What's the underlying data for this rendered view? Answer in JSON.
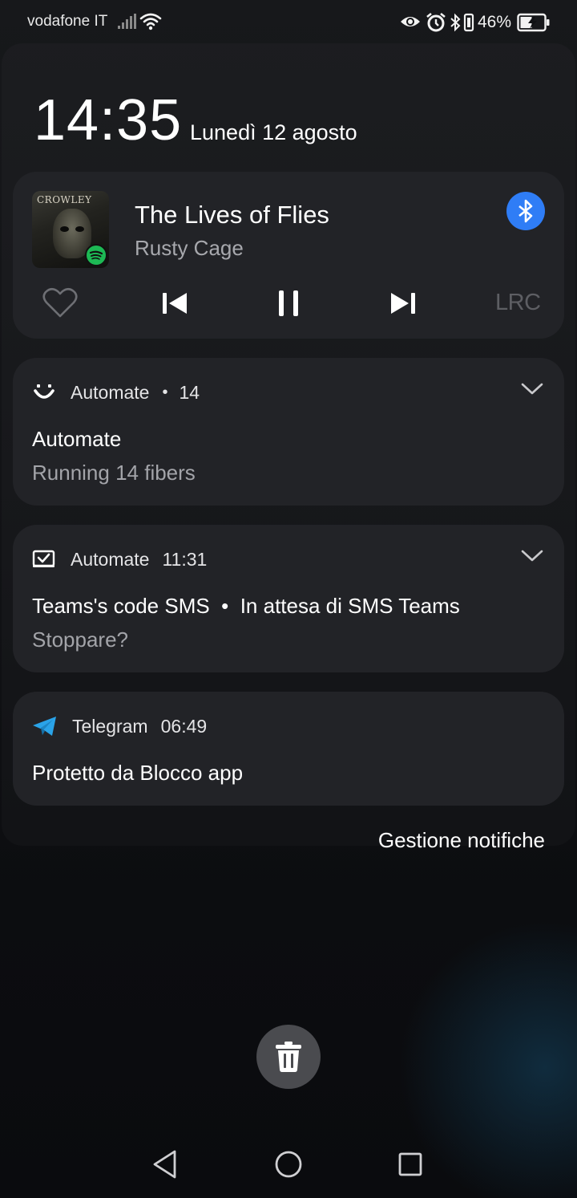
{
  "status_bar": {
    "carrier": "vodafone IT",
    "battery_percent": "46%",
    "icons": [
      "signal-icon",
      "wifi-icon",
      "eye-icon",
      "alarm-icon",
      "bluetooth-icon",
      "vibrate-icon",
      "battery-charging-icon"
    ]
  },
  "lockscreen": {
    "time": "14:35",
    "date": "Lunedì 12 agosto"
  },
  "media": {
    "album_text": "CROWLEY",
    "title": "The Lives of Flies",
    "artist": "Rusty Cage",
    "lyrics_label": "LRC",
    "accent_color": "#2f7df6",
    "spotify_color": "#1db954"
  },
  "notifications": [
    {
      "app": "Automate",
      "meta": "14",
      "title": "Automate",
      "body": "Running 14 fibers"
    },
    {
      "app": "Automate",
      "meta": "11:31",
      "title": "Teams's code SMS  •  In attesa di SMS Teams",
      "body": "Stoppare?"
    },
    {
      "app": "Telegram",
      "meta": "06:49",
      "title": "Protetto da Blocco app"
    }
  ],
  "manage_label": "Gestione notifiche",
  "telegram_color": "#2aa3e8"
}
